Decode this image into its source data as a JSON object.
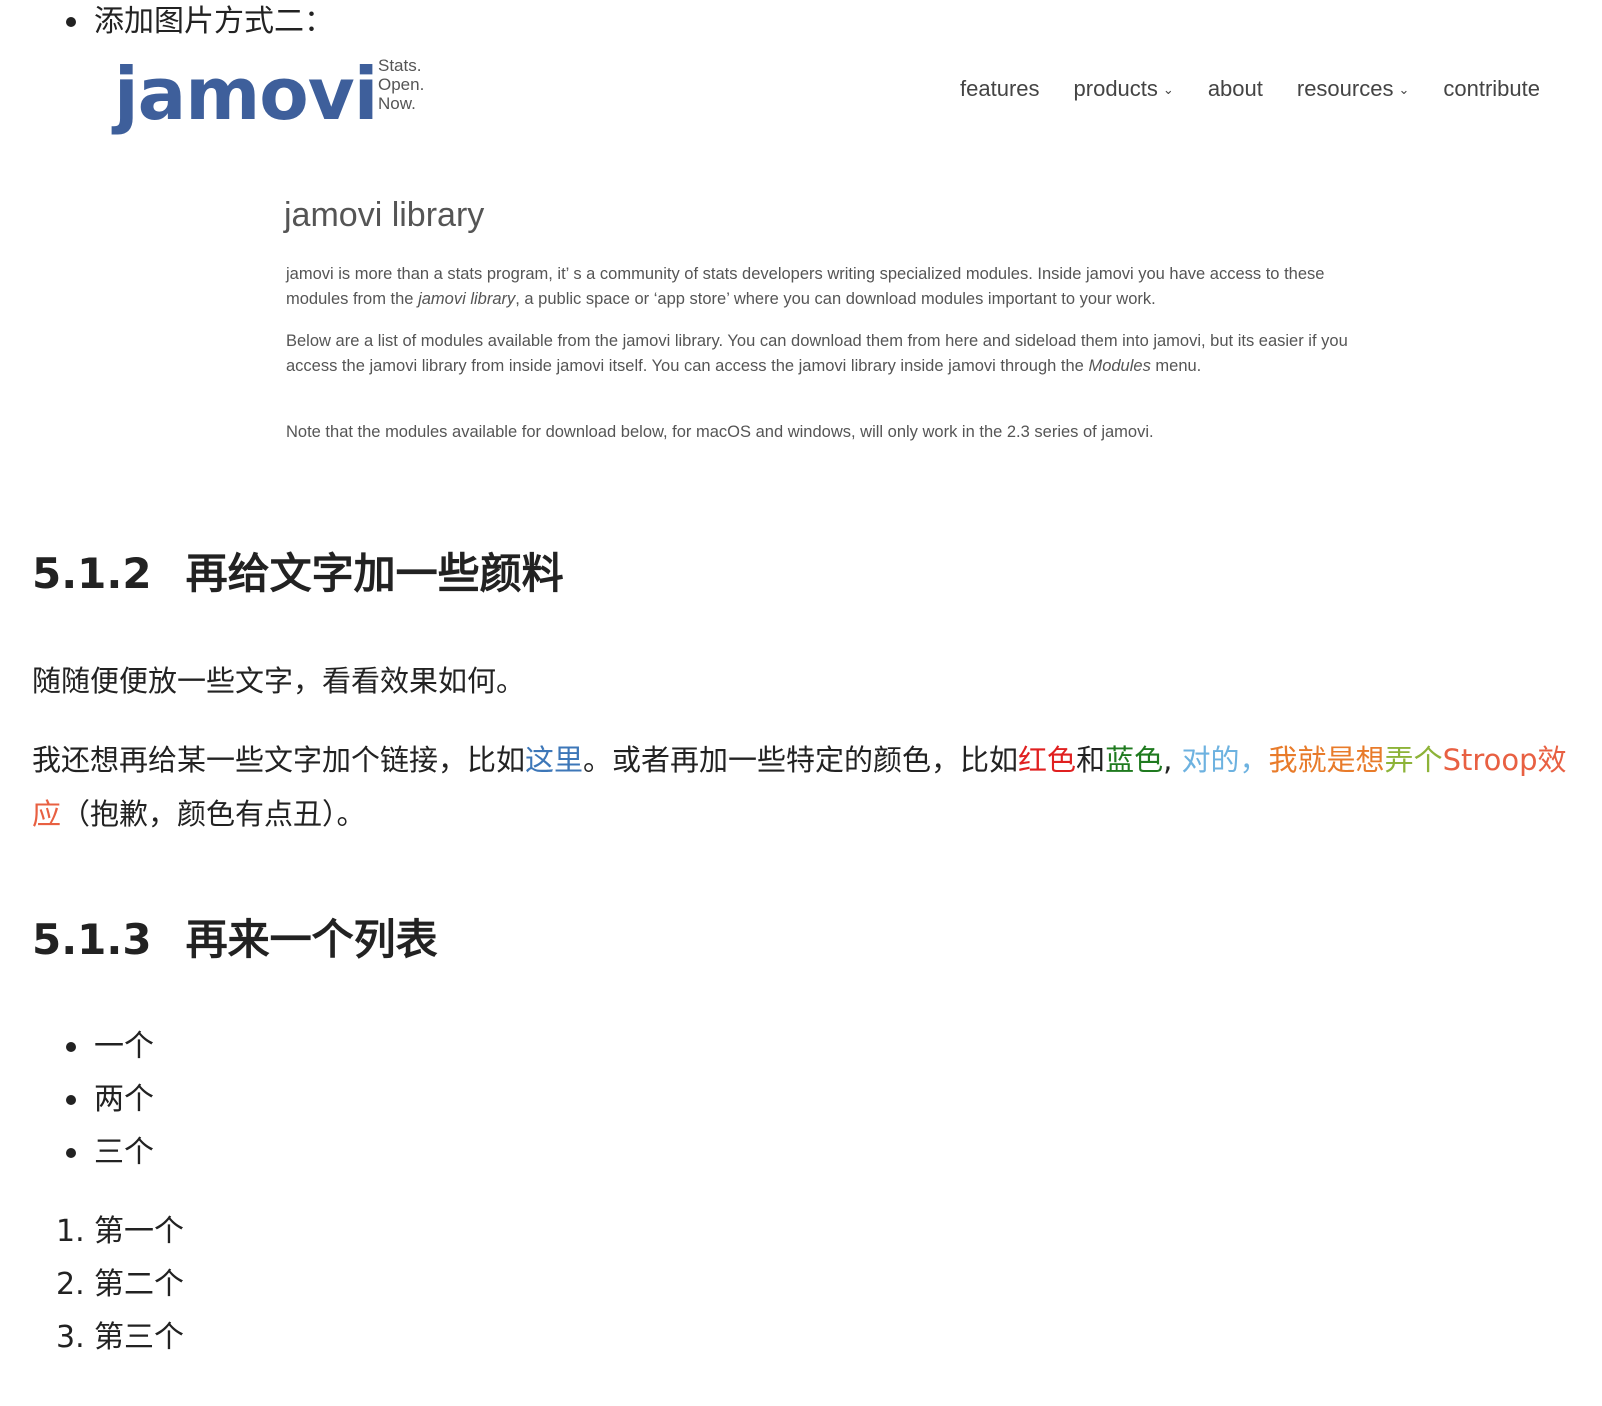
{
  "top_bullet": "添加图片方式二：",
  "embedded_image": {
    "logo": "jamovi",
    "tagline": [
      "Stats.",
      "Open.",
      "Now."
    ],
    "nav": [
      {
        "label": "features",
        "dropdown": false
      },
      {
        "label": "products",
        "dropdown": true
      },
      {
        "label": "about",
        "dropdown": false
      },
      {
        "label": "resources",
        "dropdown": true
      },
      {
        "label": "contribute",
        "dropdown": false
      }
    ],
    "title": "jamovi library",
    "para1": {
      "a": "jamovi is more than a stats program, it’ s a community of stats developers writing specialized modules. Inside jamovi you have access to these modules from the ",
      "em": "jamovi library",
      "b": ", a public space or  ‘app store’  where you can download modules important to your work."
    },
    "para2": {
      "a": "Below are a list of modules available from the jamovi library. You can download them from here and sideload them into jamovi, but its easier if you access the jamovi library from inside jamovi itself. You can access the jamovi library inside jamovi through the ",
      "em": "Modules",
      "b": " menu."
    },
    "para3": "Note that the modules available for download below, for macOS and windows, will only work in the 2.3 series of jamovi."
  },
  "section_512": {
    "number": "5.1.2",
    "title": "再给文字加一些颜料",
    "para1": "随随便便放一些文字，看看效果如何。",
    "para2": {
      "t1": "我还想再给某一些文字加个链接，比如",
      "link": "这里",
      "t2": "。或者再加一些特定的颜色，比如",
      "red": "红色",
      "t3": "和",
      "green": "蓝色",
      "t4": ", ",
      "skyblue": "对的，",
      "orange": "我就是想",
      "yellowgreen": "弄个",
      "tomato": "Stroop效应",
      "t5": "（抱歉，颜色有点丑）。"
    }
  },
  "section_513": {
    "number": "5.1.3",
    "title": "再来一个列表",
    "ul": [
      "一个",
      "两个",
      "三个"
    ],
    "ol": [
      {
        "n": "1.",
        "text": "第一个"
      },
      {
        "n": "2.",
        "text": "第二个"
      },
      {
        "n": "3.",
        "text": "第三个"
      }
    ]
  }
}
